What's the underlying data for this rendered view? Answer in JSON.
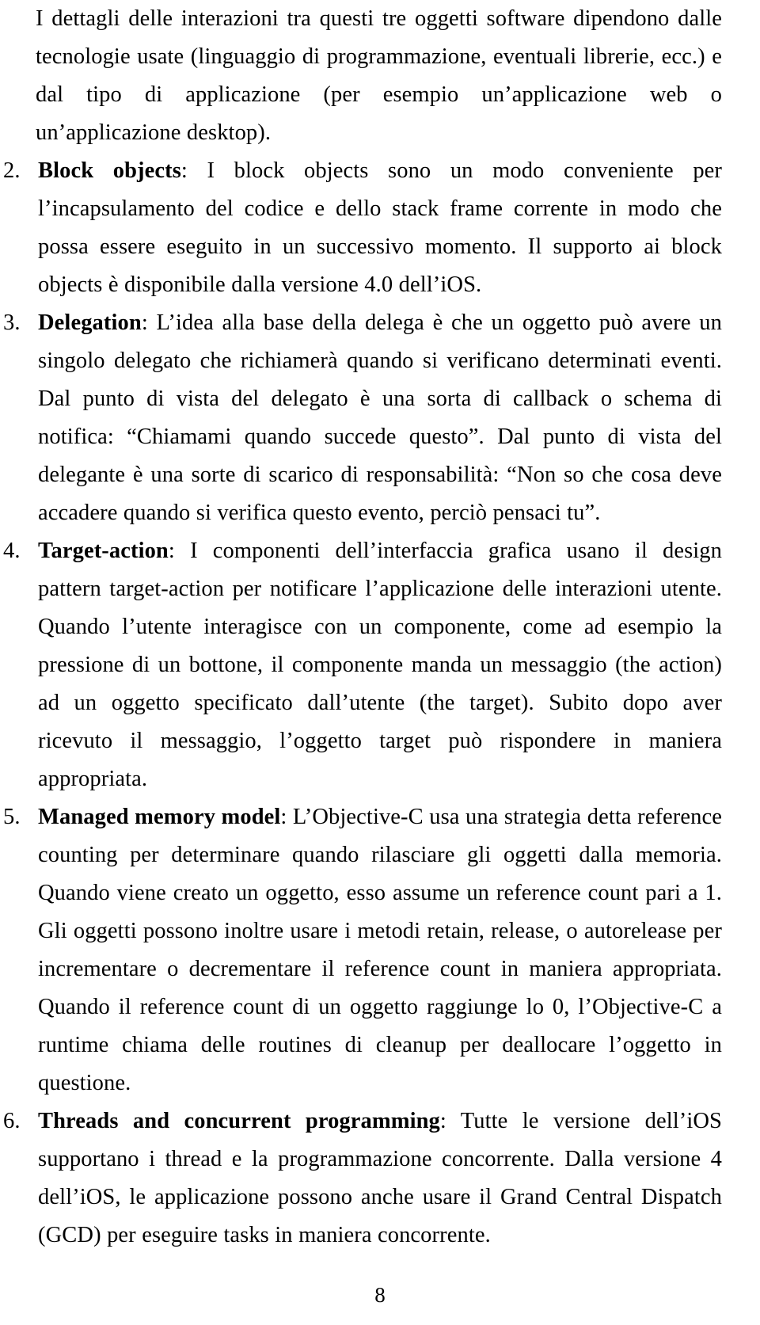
{
  "document": {
    "language": "it",
    "page_number": "8",
    "intro_paragraph": "I dettagli delle interazioni tra questi tre oggetti software dipendono dalle tecnologie usate (linguaggio di programmazione, eventuali librerie, ecc.) e dal tipo di applicazione (per esempio un’applicazione web o un’applicazione desktop).",
    "list": [
      {
        "marker": "2.",
        "term": "Block objects",
        "separator": ": ",
        "text": "I block objects sono un modo conveniente per l’incapsulamento del codice e dello stack frame corrente in modo che possa essere eseguito in un successivo momento. Il supporto ai block objects è disponibile dalla versione 4.0 dell’iOS."
      },
      {
        "marker": "3.",
        "term": "Delegation",
        "separator": ": ",
        "text": "L’idea alla base della delega è che un oggetto può avere un singolo delegato che richiamerà quando si verificano determinati eventi. Dal punto di vista del delegato è una sorta di callback o schema di notifica: “Chiamami quando succede questo”. Dal punto di vista del delegante è una sorte di scarico di responsabilità: “Non so che cosa deve accadere quando si verifica questo evento, perciò pensaci tu”."
      },
      {
        "marker": "4.",
        "term": "Target-action",
        "separator": ": ",
        "text": "I componenti dell’interfaccia grafica usano il design pattern target-action per notificare l’applicazione delle interazioni utente. Quando l’utente interagisce con un componente, come ad esempio la pressione di un bottone, il componente manda un messaggio (the action) ad un oggetto specificato dall’utente (the target). Subito dopo aver ricevuto il messaggio, l’oggetto target può rispondere in maniera appropriata."
      },
      {
        "marker": "5.",
        "term": "Managed memory model",
        "separator": ": ",
        "text": "L’Objective-C usa una strategia detta reference counting per determinare quando rilasciare gli oggetti dalla memoria. Quando viene creato un oggetto, esso assume un reference count pari a 1. Gli oggetti possono inoltre usare i metodi retain, release, o autorelease per incrementare o decrementare il reference count in maniera appropriata. Quando il reference count di un oggetto raggiunge lo 0, l’Objective-C a runtime chiama delle routines di cleanup per deallocare l’oggetto in questione."
      },
      {
        "marker": "6.",
        "term": "Threads and concurrent programming",
        "separator": ": ",
        "text": "Tutte le versione dell’iOS supportano i thread e la programmazione concorrente. Dalla versione 4 dell’iOS, le applicazione possono anche usare il Grand Central Dispatch (GCD) per eseguire tasks in maniera concorrente."
      }
    ]
  }
}
